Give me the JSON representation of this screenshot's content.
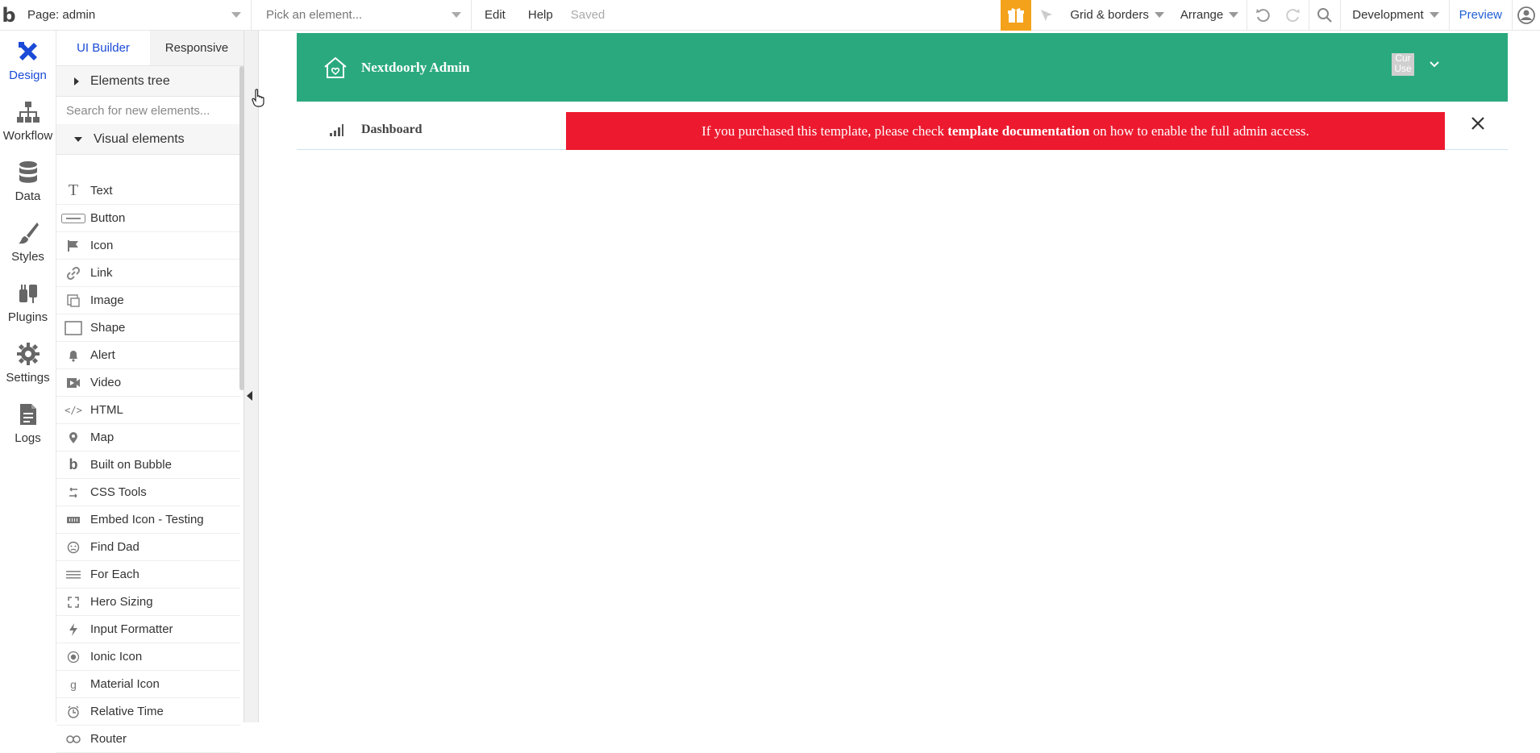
{
  "topbar": {
    "logo": "b",
    "page_label": "Page: admin",
    "element_placeholder": "Pick an element...",
    "menu_edit": "Edit",
    "menu_help": "Help",
    "status": "Saved",
    "grid": "Grid & borders",
    "arrange": "Arrange",
    "environment": "Development",
    "preview": "Preview",
    "gift_color": "#f4a21b"
  },
  "nav": {
    "design": "Design",
    "workflow": "Workflow",
    "data": "Data",
    "styles": "Styles",
    "plugins": "Plugins",
    "settings": "Settings",
    "logs": "Logs"
  },
  "panel": {
    "tab_ui": "UI Builder",
    "tab_responsive": "Responsive",
    "elements_tree": "Elements tree",
    "search_placeholder": "Search for new elements...",
    "visual_elements": "Visual elements",
    "items": [
      {
        "label": "Text",
        "icon": "text-icon"
      },
      {
        "label": "Button",
        "icon": "button-icon"
      },
      {
        "label": "Icon",
        "icon": "flag-icon"
      },
      {
        "label": "Link",
        "icon": "link-icon"
      },
      {
        "label": "Image",
        "icon": "image-icon"
      },
      {
        "label": "Shape",
        "icon": "shape-icon"
      },
      {
        "label": "Alert",
        "icon": "bell-icon"
      },
      {
        "label": "Video",
        "icon": "video-icon"
      },
      {
        "label": "HTML",
        "icon": "code-icon"
      },
      {
        "label": "Map",
        "icon": "map-pin-icon"
      },
      {
        "label": "Built on Bubble",
        "icon": "bubble-icon"
      },
      {
        "label": "CSS Tools",
        "icon": "css-tools-icon"
      },
      {
        "label": "Embed Icon - Testing",
        "icon": "embed-icon"
      },
      {
        "label": "Find Dad",
        "icon": "face-icon"
      },
      {
        "label": "For Each",
        "icon": "lines-icon"
      },
      {
        "label": "Hero Sizing",
        "icon": "expand-icon"
      },
      {
        "label": "Input Formatter",
        "icon": "bolt-icon"
      },
      {
        "label": "Ionic Icon",
        "icon": "radio-icon"
      },
      {
        "label": "Material Icon",
        "icon": "material-icon"
      },
      {
        "label": "Relative Time",
        "icon": "clock-icon"
      },
      {
        "label": "Router",
        "icon": "router-icon"
      }
    ]
  },
  "canvas": {
    "brand": "Nextdoorly Admin",
    "avatar_text": "Cur Use",
    "dashboard": "Dashboard",
    "alert_pre": "If you purchased this template, please check ",
    "alert_bold": "template documentation",
    "alert_post": " on how to enable the full admin access.",
    "header_color": "#2aa97f",
    "alert_color": "#ed1a2f"
  }
}
